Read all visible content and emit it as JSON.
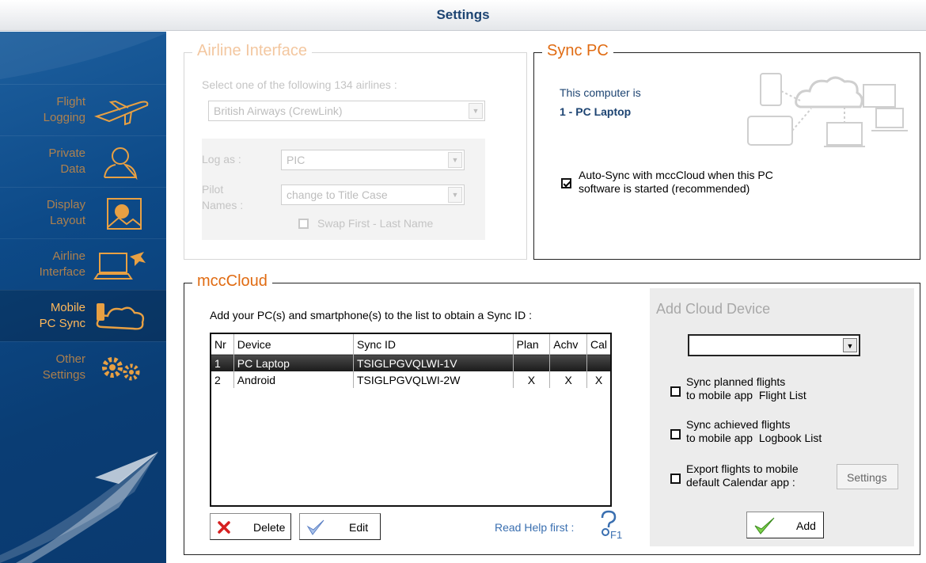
{
  "window": {
    "title": "Settings"
  },
  "sidebar": {
    "items": [
      {
        "label": "Flight\nLogging",
        "icon": "airplane-icon"
      },
      {
        "label": "Private\nData",
        "icon": "person-icon"
      },
      {
        "label": "Display\nLayout",
        "icon": "picture-icon"
      },
      {
        "label": "Airline\nInterface",
        "icon": "laptop-plane-icon"
      },
      {
        "label": "Mobile\nPC Sync",
        "icon": "phone-cloud-icon"
      },
      {
        "label": "Other\nSettings",
        "icon": "gears-icon"
      }
    ]
  },
  "airline": {
    "title": "Airline Interface",
    "prompt": "Select one of the following 134 airlines :",
    "airline_value": "British Airways  (CrewLink)",
    "log_as_label": "Log as :",
    "log_as_value": "PIC",
    "pilot_names_label": "Pilot\nNames :",
    "pilot_names_value": "change to Title Case",
    "swap_label": "Swap First - Last Name"
  },
  "sync_pc": {
    "title": "Sync PC",
    "computer_is": "This computer is",
    "computer_name": "1 - PC Laptop",
    "autosync_label": "Auto-Sync with mccCloud when this PC\nsoftware is started (recommended)",
    "autosync_checked": true
  },
  "mcc": {
    "title": "mccCloud",
    "instruction": "Add your PC(s) and smartphone(s) to the list to obtain a Sync ID :",
    "columns": [
      "Nr",
      "Device",
      "Sync ID",
      "Plan",
      "Achv",
      "Cal"
    ],
    "rows": [
      {
        "nr": "1",
        "device": "PC Laptop",
        "sync_id": "TSIGLPGVQLWI-1V",
        "plan": "",
        "achv": "",
        "cal": "",
        "selected": true
      },
      {
        "nr": "2",
        "device": "Android",
        "sync_id": "TSIGLPGVQLWI-2W",
        "plan": "X",
        "achv": "X",
        "cal": "X",
        "selected": false
      }
    ],
    "delete_label": "Delete",
    "edit_label": "Edit",
    "help_label": "Read Help first :",
    "help_key": "F1"
  },
  "add_device": {
    "title": "Add Cloud Device",
    "device_value": "",
    "opt_planned": "Sync planned flights\nto mobile app  Flight List",
    "opt_achieved": "Sync achieved flights\nto mobile app  Logbook List",
    "opt_export": "Export flights to mobile\ndefault Calendar app :",
    "settings_label": "Settings",
    "add_label": "Add"
  },
  "colors": {
    "accent": "#e06b12",
    "sidebar": "#0d4a88",
    "nav_text": "#e8a043",
    "title": "#1d4472"
  }
}
